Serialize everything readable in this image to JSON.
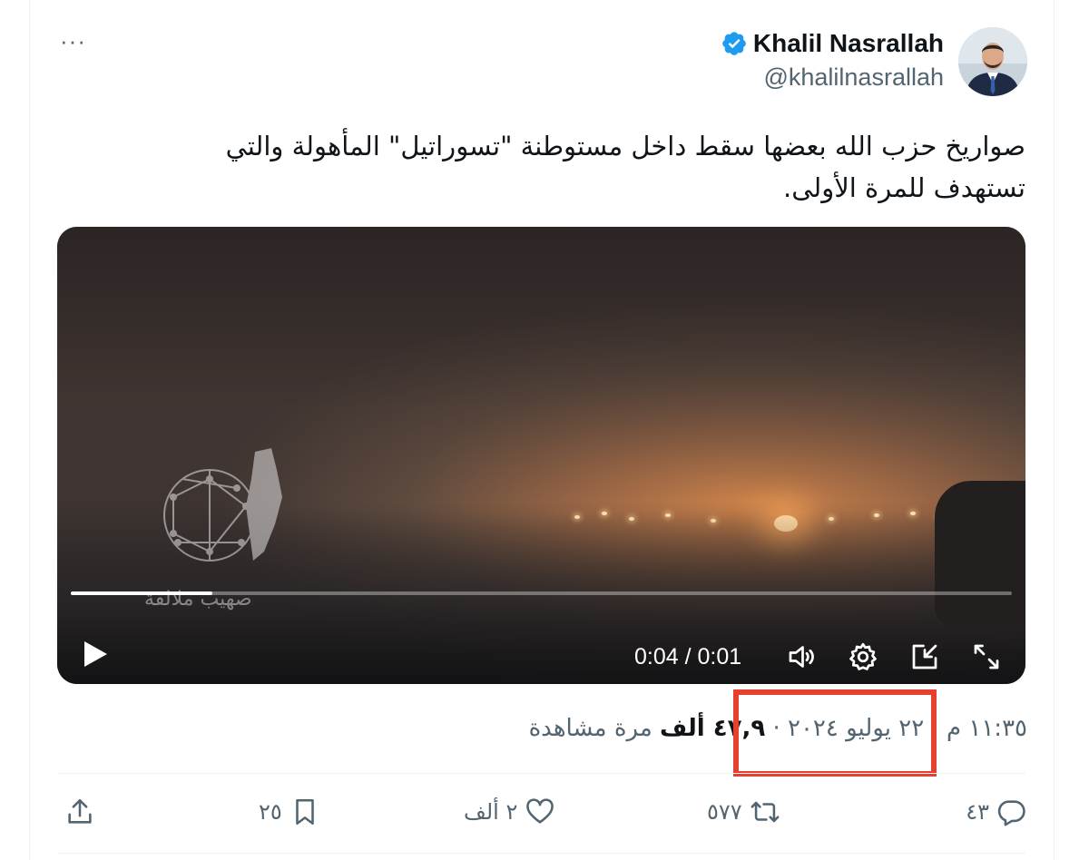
{
  "author": {
    "name": "Khalil Nasrallah",
    "handle": "@khalilnasrallah",
    "verified": true
  },
  "menu": {
    "more_label": "···"
  },
  "tweet": {
    "text_line1": "صواريخ حزب الله بعضها سقط داخل مستوطنة \"تسوراتيل\" المأهولة والتي",
    "text_line2": "تستهدف للمرة الأولى."
  },
  "video": {
    "time_display": "0:04 / 0:01",
    "progress_fraction": 0.15,
    "watermark_text": "صهيب ملالقة"
  },
  "meta": {
    "time": "١١:٣٥ م",
    "date": "٢٢ يوليو ٢٠٢٤",
    "views_count": "٤٧,٩ ألف",
    "views_label": "مرة مشاهدة",
    "separator": "·"
  },
  "actions": {
    "reply_count": "٤٣",
    "retweet_count": "٥٧٧",
    "like_count": "٢ ألف",
    "bookmark_count": "٢٥"
  },
  "colors": {
    "accent_blue": "#1d9bf0",
    "muted_text": "#536471",
    "highlight_box": "#e8402f"
  },
  "icons": {
    "verified": "verified-badge-icon",
    "play": "play-icon",
    "volume": "volume-icon",
    "settings": "gear-icon",
    "pip": "picture-in-picture-icon",
    "fullscreen": "fullscreen-icon",
    "reply": "reply-icon",
    "retweet": "retweet-icon",
    "like": "heart-icon",
    "bookmark": "bookmark-icon",
    "share": "share-icon"
  }
}
